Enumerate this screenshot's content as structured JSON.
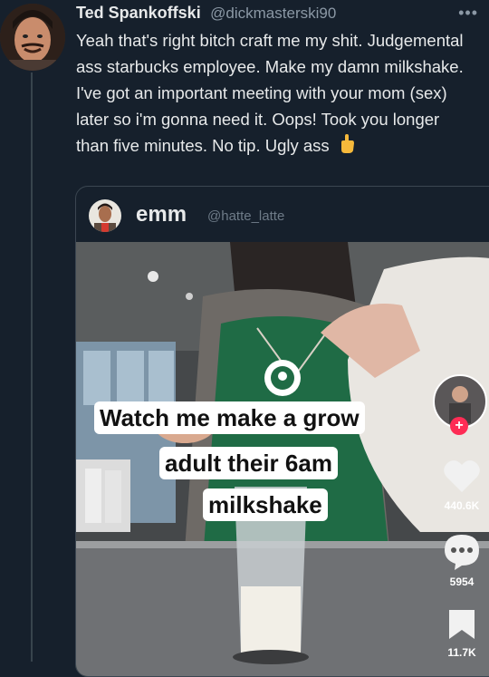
{
  "tweet": {
    "display_name": "Ted Spankoffski",
    "handle": "@dickmasterski90",
    "text": "Yeah that's right bitch craft me my shit. Judgemental ass starbucks employee. Make my damn milkshake. I've got an important meeting with your mom (sex) later so i'm gonna need it. Oops! Took you longer than five minutes. No tip. Ugly ass",
    "more_icon": "more-horizontal-icon",
    "emoji_icon": "middle-finger-icon"
  },
  "quote": {
    "display_name": "emm",
    "handle": "@hatte_latte"
  },
  "video": {
    "caption_lines": [
      "Watch me make a grow",
      "adult their 6am",
      "milkshake"
    ],
    "likes": "440.6K",
    "comments": "5954",
    "saves": "11.7K",
    "icons": {
      "follow": "plus-icon",
      "like": "heart-icon",
      "comment": "comment-dots-icon",
      "save": "bookmark-icon"
    }
  },
  "colors": {
    "background": "#16202c",
    "text": "#e7e9ea",
    "muted": "#8b98a5",
    "tiktok_red": "#fe2c55",
    "apron_green": "#1f6b45"
  }
}
